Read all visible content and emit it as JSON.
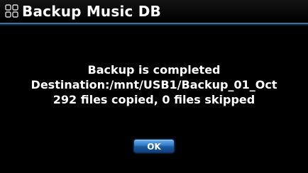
{
  "window": {
    "title": "Backup Music DB",
    "title_icon": "grid-icon"
  },
  "dialog": {
    "lines": [
      "Backup is completed",
      "Destination:/mnt/USB1/Backup_01_Oct",
      "292 files copied, 0 files skipped"
    ],
    "ok_label": "OK"
  },
  "colors": {
    "background": "#000000",
    "text": "#ffffff",
    "accent": "#3d6f9e",
    "button": "#2f78c4"
  }
}
